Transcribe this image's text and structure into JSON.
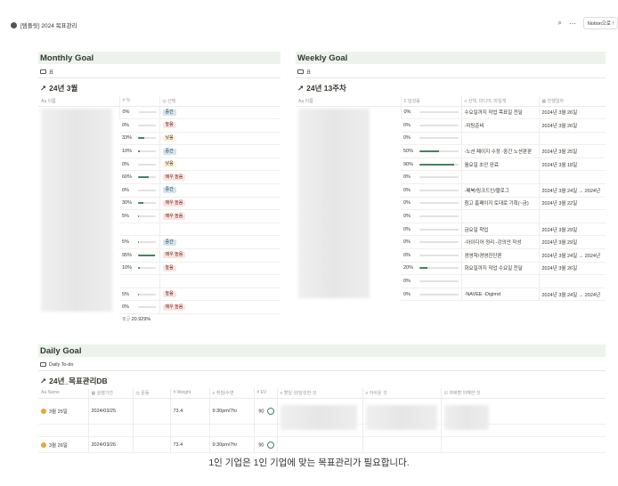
{
  "topbar": {
    "breadcrumb": "[템플릿] 2024 목표관리",
    "share_button": "Notion으로 !"
  },
  "monthly": {
    "section_title": "Monthly Goal",
    "view_tab": "표",
    "db_title": "24년 3월",
    "columns": [
      "이름",
      "%",
      "선택"
    ],
    "rows": [
      {
        "value": "0%",
        "pct": 0,
        "tag": "중간",
        "tone": "mid"
      },
      {
        "value": "0%",
        "pct": 0,
        "tag": "높음",
        "tone": "high"
      },
      {
        "value": "33%",
        "pct": 33,
        "tag": "낮음",
        "tone": "low"
      },
      {
        "value": "10%",
        "pct": 10,
        "tag": "중간",
        "tone": "mid"
      },
      {
        "value": "0%",
        "pct": 0,
        "tag": "낮음",
        "tone": "low"
      },
      {
        "value": "60%",
        "pct": 60,
        "tag": "매우 높음",
        "tone": "vhigh"
      },
      {
        "value": "0%",
        "pct": 0,
        "tag": "중간",
        "tone": "mid"
      },
      {
        "value": "30%",
        "pct": 30,
        "tag": "매우 높음",
        "tone": "vhigh"
      },
      {
        "value": "5%",
        "pct": 5,
        "tag": "매우 높음",
        "tone": "vhigh"
      },
      {
        "value": "",
        "pct": null,
        "tag": "",
        "tone": ""
      },
      {
        "value": "5%",
        "pct": 5,
        "tag": "중간",
        "tone": "mid"
      },
      {
        "value": "95%",
        "pct": 95,
        "tag": "매우 높음",
        "tone": "vhigh"
      },
      {
        "value": "10%",
        "pct": 10,
        "tag": "높음",
        "tone": "high"
      },
      {
        "value": "",
        "pct": null,
        "tag": "",
        "tone": ""
      },
      {
        "value": "5%",
        "pct": 5,
        "tag": "높음",
        "tone": "high"
      },
      {
        "value": "0%",
        "pct": 0,
        "tag": "매우 높음",
        "tone": "vhigh"
      }
    ],
    "summary_label": "평균",
    "summary_value": "20.929%"
  },
  "weekly": {
    "section_title": "Weekly Goal",
    "view_tab": "표",
    "db_title": "24년 13주차",
    "columns": [
      "이름",
      "달성률",
      "산책, 미디어, 마일게",
      "진행일자"
    ],
    "rows": [
      {
        "value": "0%",
        "pct": 0,
        "note": "수요일까지 작업 목표일 전달",
        "date": "2024년 3월 26일"
      },
      {
        "value": "0%",
        "pct": 0,
        "note": "-미팅준비",
        "date": "2024년 3월 26일"
      },
      {
        "value": "0%",
        "pct": 0,
        "note": "",
        "date": ""
      },
      {
        "value": "50%",
        "pct": 50,
        "note": "-노션 페이지 수정 -중간 노션판판",
        "date": "2024년 3월 25일"
      },
      {
        "value": "90%",
        "pct": 90,
        "note": "월요일 초안 완료",
        "date": "2024년 3월 18일"
      },
      {
        "value": "0%",
        "pct": 0,
        "note": "",
        "date": ""
      },
      {
        "value": "0%",
        "pct": 0,
        "note": "-페북/링크드인/블로그",
        "date": "2024년 3월 24일 → 2024년"
      },
      {
        "value": "0%",
        "pct": 0,
        "note": "참고 홈페이지 토대로 기획(~금)",
        "date": "2024년 3월 22일"
      },
      {
        "value": "0%",
        "pct": 0,
        "note": "",
        "date": ""
      },
      {
        "value": "0%",
        "pct": 0,
        "note": "금요일 착업",
        "date": "2024년 3월 29일"
      },
      {
        "value": "0%",
        "pct": 0,
        "note": "-아이디어 정리 -강의안 작성",
        "date": "2024년 3월 29일"
      },
      {
        "value": "0%",
        "pct": 0,
        "note": "경영학/경영진단론",
        "date": "2024년 3월 24일 → 2024년"
      },
      {
        "value": "20%",
        "pct": 20,
        "note": "화요일까지 작업 수요일 전달",
        "date": "2024년 3월 26일"
      },
      {
        "value": "0%",
        "pct": 0,
        "note": "",
        "date": ""
      },
      {
        "value": "0%",
        "pct": 0,
        "note": "-NAVEE -Digimd",
        "date": "2024년 3월 24일 → 2024년"
      }
    ]
  },
  "daily": {
    "section_title": "Daily Goal",
    "view_tab": "Daily To-do",
    "db_title": "24년_목표관리DB",
    "columns": [
      "Name",
      "실행기간",
      "운동",
      "Weight",
      "취침/수면",
      "EV",
      "할일 성/달성한 것",
      "아쉬운 것",
      "자배할 의해한 것"
    ],
    "rows": [
      {
        "name": "3월 25일",
        "period": "2024/03/25",
        "weight": "73.4",
        "sleep": "9:30pm/7hr",
        "ev": "90"
      },
      {
        "name": "3월 26일",
        "period": "2024/03/26",
        "weight": "73.4",
        "sleep": "9:30pm/7hr",
        "ev": "90"
      }
    ]
  },
  "caption": "1인 기업은 1인 기업에 맞는 목표관리가 필요합니다."
}
